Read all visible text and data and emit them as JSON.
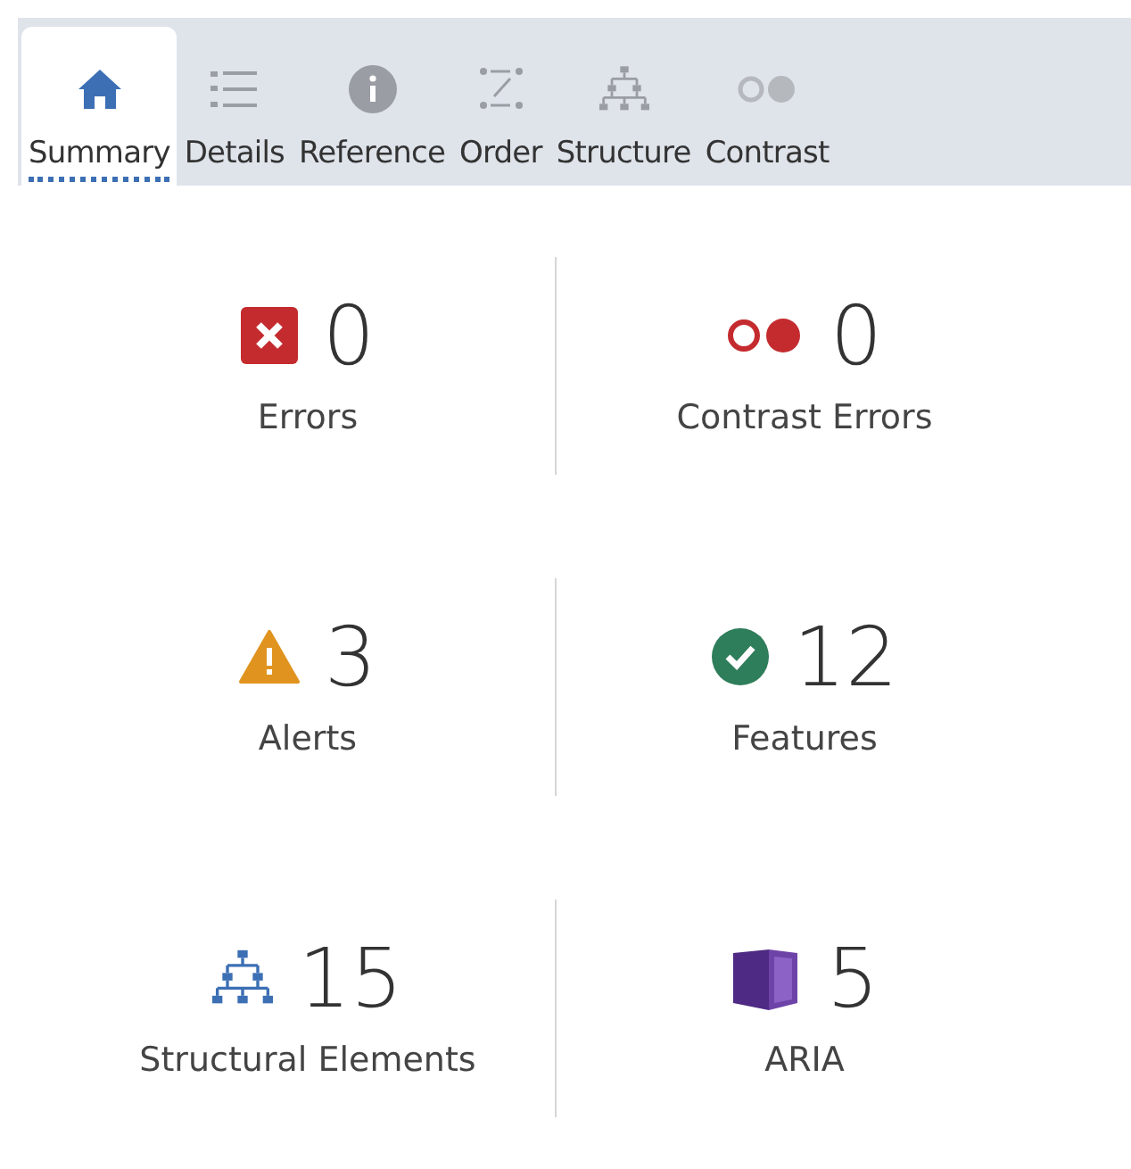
{
  "tabs": [
    {
      "label": "Summary",
      "kind": "home",
      "selected": true
    },
    {
      "label": "Details",
      "kind": "list",
      "selected": false
    },
    {
      "label": "Reference",
      "kind": "info",
      "selected": false
    },
    {
      "label": "Order",
      "kind": "order",
      "selected": false
    },
    {
      "label": "Structure",
      "kind": "structure",
      "selected": false
    },
    {
      "label": "Contrast",
      "kind": "contrast",
      "selected": false
    }
  ],
  "stats": [
    {
      "kind": "error",
      "count": "0",
      "label": "Errors"
    },
    {
      "kind": "contrast",
      "count": "0",
      "label": "Contrast Errors"
    },
    {
      "kind": "alert",
      "count": "3",
      "label": "Alerts"
    },
    {
      "kind": "feature",
      "count": "12",
      "label": "Features"
    },
    {
      "kind": "structure",
      "count": "15",
      "label": "Structural Elements"
    },
    {
      "kind": "aria",
      "count": "5",
      "label": "ARIA"
    }
  ]
}
